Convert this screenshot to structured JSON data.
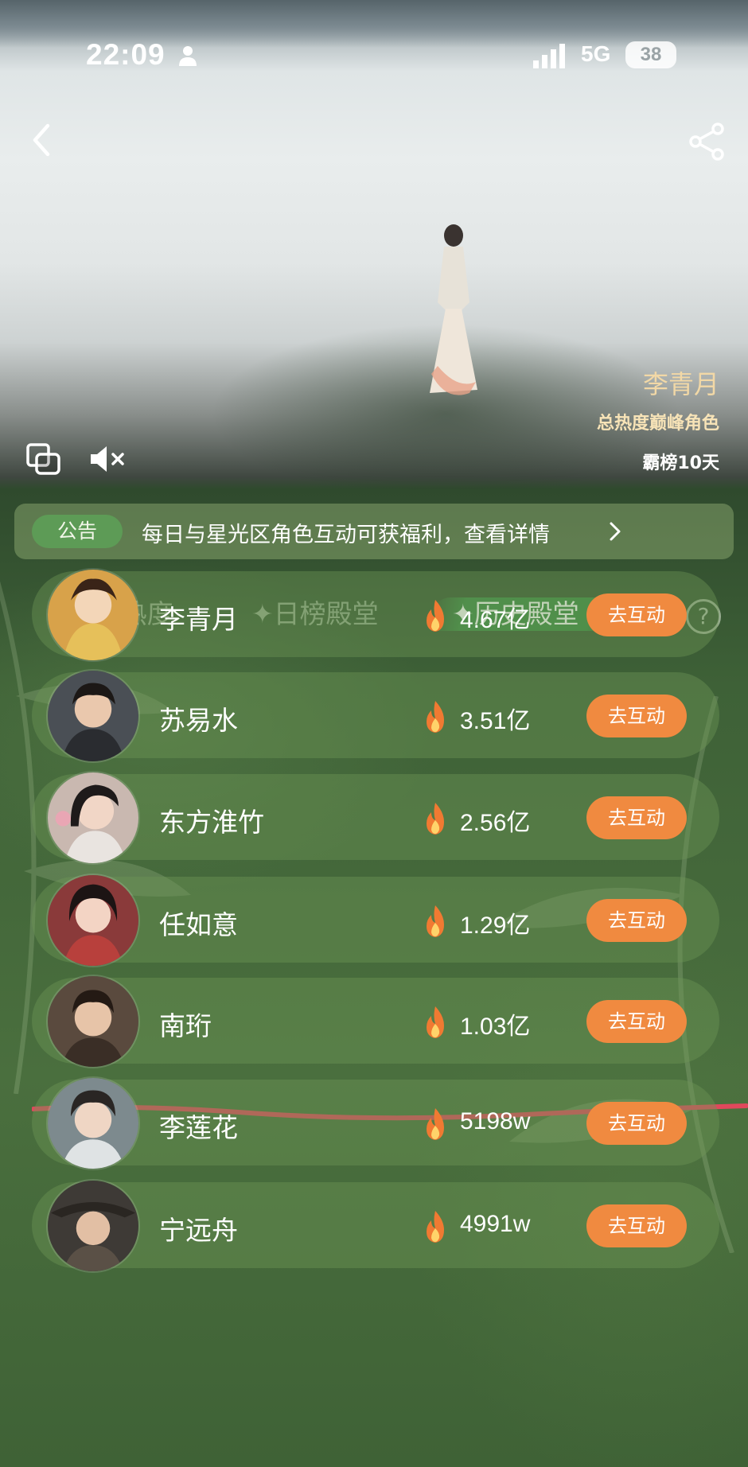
{
  "status_bar": {
    "time": "22:09",
    "network": "5G",
    "battery": "38"
  },
  "hero": {
    "character_name": "李青月",
    "subtitle": "总热度巅峰角色",
    "days_on_top": "霸榜10天"
  },
  "notice": {
    "tag": "公告",
    "text": "每日与星光区角色互动可获福利，查看详情"
  },
  "tabs": [
    {
      "label": "✦今日热度",
      "active": false
    },
    {
      "label": "✦日榜殿堂",
      "active": false
    },
    {
      "label": "✦历史殿堂",
      "active": true
    }
  ],
  "help_label": "?",
  "rank_list": [
    {
      "name": "李青月",
      "score": "4.67亿",
      "button": "去互动",
      "avatar_color": "#d8a24a"
    },
    {
      "name": "苏易水",
      "score": "3.51亿",
      "button": "去互动",
      "avatar_color": "#4a4f55"
    },
    {
      "name": "东方淮竹",
      "score": "2.56亿",
      "button": "去互动",
      "avatar_color": "#c9b8b0"
    },
    {
      "name": "任如意",
      "score": "1.29亿",
      "button": "去互动",
      "avatar_color": "#8a3a3a"
    },
    {
      "name": "南珩",
      "score": "1.03亿",
      "button": "去互动",
      "avatar_color": "#5a4a3e"
    },
    {
      "name": "李莲花",
      "score": "5198w",
      "button": "去互动",
      "avatar_color": "#7d8a8e"
    },
    {
      "name": "宁远舟",
      "score": "4991w",
      "button": "去互动",
      "avatar_color": "#3e3a36"
    }
  ],
  "colors": {
    "accent_button": "#f08a40",
    "notice_tag": "#5d9b56",
    "marker_line": "#e0485c"
  }
}
